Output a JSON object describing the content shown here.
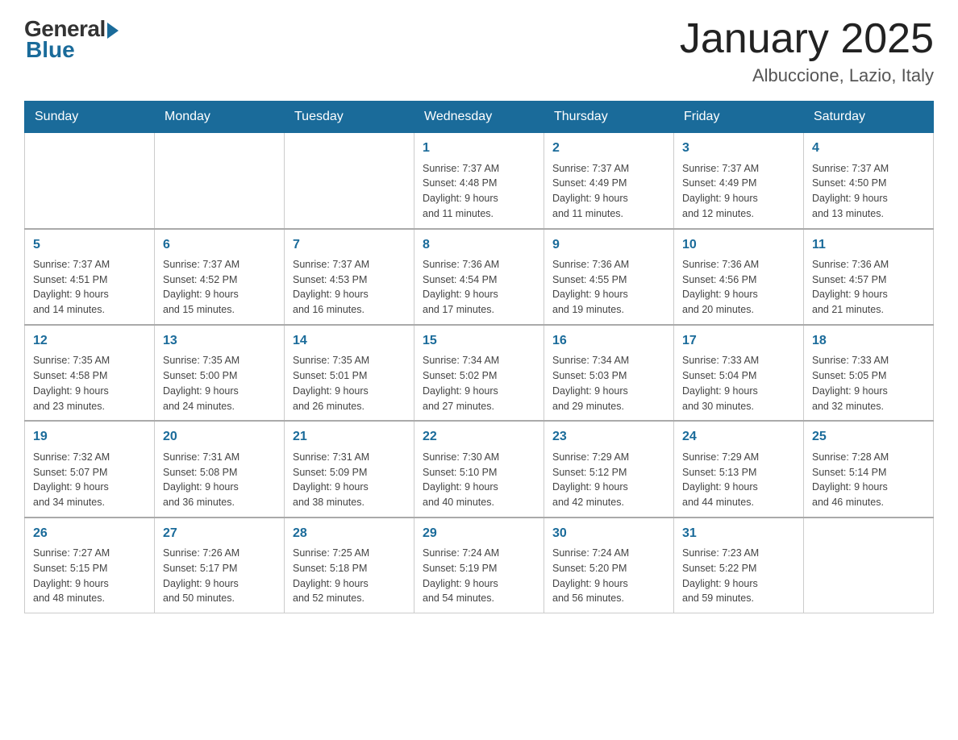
{
  "logo": {
    "general": "General",
    "blue": "Blue"
  },
  "calendar": {
    "title": "January 2025",
    "subtitle": "Albuccione, Lazio, Italy",
    "days_of_week": [
      "Sunday",
      "Monday",
      "Tuesday",
      "Wednesday",
      "Thursday",
      "Friday",
      "Saturday"
    ],
    "weeks": [
      [
        {
          "day": "",
          "info": ""
        },
        {
          "day": "",
          "info": ""
        },
        {
          "day": "",
          "info": ""
        },
        {
          "day": "1",
          "info": "Sunrise: 7:37 AM\nSunset: 4:48 PM\nDaylight: 9 hours\nand 11 minutes."
        },
        {
          "day": "2",
          "info": "Sunrise: 7:37 AM\nSunset: 4:49 PM\nDaylight: 9 hours\nand 11 minutes."
        },
        {
          "day": "3",
          "info": "Sunrise: 7:37 AM\nSunset: 4:49 PM\nDaylight: 9 hours\nand 12 minutes."
        },
        {
          "day": "4",
          "info": "Sunrise: 7:37 AM\nSunset: 4:50 PM\nDaylight: 9 hours\nand 13 minutes."
        }
      ],
      [
        {
          "day": "5",
          "info": "Sunrise: 7:37 AM\nSunset: 4:51 PM\nDaylight: 9 hours\nand 14 minutes."
        },
        {
          "day": "6",
          "info": "Sunrise: 7:37 AM\nSunset: 4:52 PM\nDaylight: 9 hours\nand 15 minutes."
        },
        {
          "day": "7",
          "info": "Sunrise: 7:37 AM\nSunset: 4:53 PM\nDaylight: 9 hours\nand 16 minutes."
        },
        {
          "day": "8",
          "info": "Sunrise: 7:36 AM\nSunset: 4:54 PM\nDaylight: 9 hours\nand 17 minutes."
        },
        {
          "day": "9",
          "info": "Sunrise: 7:36 AM\nSunset: 4:55 PM\nDaylight: 9 hours\nand 19 minutes."
        },
        {
          "day": "10",
          "info": "Sunrise: 7:36 AM\nSunset: 4:56 PM\nDaylight: 9 hours\nand 20 minutes."
        },
        {
          "day": "11",
          "info": "Sunrise: 7:36 AM\nSunset: 4:57 PM\nDaylight: 9 hours\nand 21 minutes."
        }
      ],
      [
        {
          "day": "12",
          "info": "Sunrise: 7:35 AM\nSunset: 4:58 PM\nDaylight: 9 hours\nand 23 minutes."
        },
        {
          "day": "13",
          "info": "Sunrise: 7:35 AM\nSunset: 5:00 PM\nDaylight: 9 hours\nand 24 minutes."
        },
        {
          "day": "14",
          "info": "Sunrise: 7:35 AM\nSunset: 5:01 PM\nDaylight: 9 hours\nand 26 minutes."
        },
        {
          "day": "15",
          "info": "Sunrise: 7:34 AM\nSunset: 5:02 PM\nDaylight: 9 hours\nand 27 minutes."
        },
        {
          "day": "16",
          "info": "Sunrise: 7:34 AM\nSunset: 5:03 PM\nDaylight: 9 hours\nand 29 minutes."
        },
        {
          "day": "17",
          "info": "Sunrise: 7:33 AM\nSunset: 5:04 PM\nDaylight: 9 hours\nand 30 minutes."
        },
        {
          "day": "18",
          "info": "Sunrise: 7:33 AM\nSunset: 5:05 PM\nDaylight: 9 hours\nand 32 minutes."
        }
      ],
      [
        {
          "day": "19",
          "info": "Sunrise: 7:32 AM\nSunset: 5:07 PM\nDaylight: 9 hours\nand 34 minutes."
        },
        {
          "day": "20",
          "info": "Sunrise: 7:31 AM\nSunset: 5:08 PM\nDaylight: 9 hours\nand 36 minutes."
        },
        {
          "day": "21",
          "info": "Sunrise: 7:31 AM\nSunset: 5:09 PM\nDaylight: 9 hours\nand 38 minutes."
        },
        {
          "day": "22",
          "info": "Sunrise: 7:30 AM\nSunset: 5:10 PM\nDaylight: 9 hours\nand 40 minutes."
        },
        {
          "day": "23",
          "info": "Sunrise: 7:29 AM\nSunset: 5:12 PM\nDaylight: 9 hours\nand 42 minutes."
        },
        {
          "day": "24",
          "info": "Sunrise: 7:29 AM\nSunset: 5:13 PM\nDaylight: 9 hours\nand 44 minutes."
        },
        {
          "day": "25",
          "info": "Sunrise: 7:28 AM\nSunset: 5:14 PM\nDaylight: 9 hours\nand 46 minutes."
        }
      ],
      [
        {
          "day": "26",
          "info": "Sunrise: 7:27 AM\nSunset: 5:15 PM\nDaylight: 9 hours\nand 48 minutes."
        },
        {
          "day": "27",
          "info": "Sunrise: 7:26 AM\nSunset: 5:17 PM\nDaylight: 9 hours\nand 50 minutes."
        },
        {
          "day": "28",
          "info": "Sunrise: 7:25 AM\nSunset: 5:18 PM\nDaylight: 9 hours\nand 52 minutes."
        },
        {
          "day": "29",
          "info": "Sunrise: 7:24 AM\nSunset: 5:19 PM\nDaylight: 9 hours\nand 54 minutes."
        },
        {
          "day": "30",
          "info": "Sunrise: 7:24 AM\nSunset: 5:20 PM\nDaylight: 9 hours\nand 56 minutes."
        },
        {
          "day": "31",
          "info": "Sunrise: 7:23 AM\nSunset: 5:22 PM\nDaylight: 9 hours\nand 59 minutes."
        },
        {
          "day": "",
          "info": ""
        }
      ]
    ]
  }
}
